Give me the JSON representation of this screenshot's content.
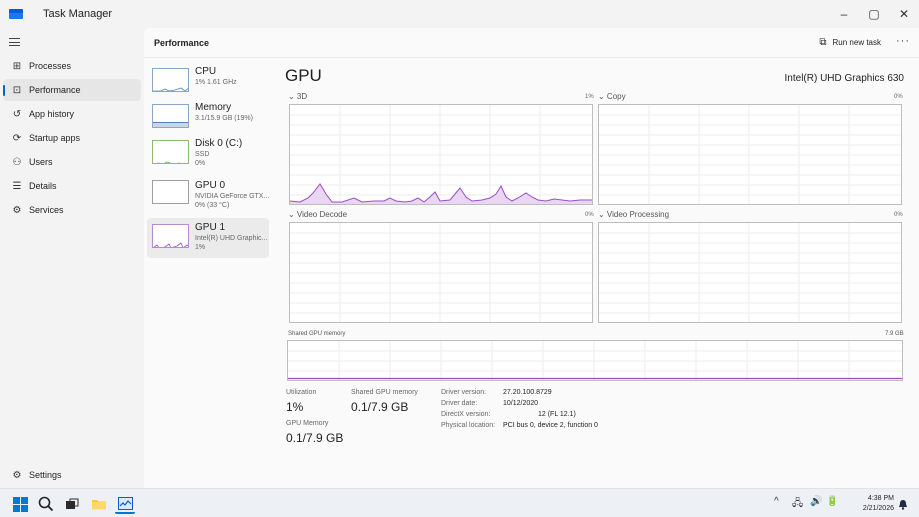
{
  "window": {
    "title": "Task Manager",
    "minimize": "–",
    "maximize": "▢",
    "close": "✕"
  },
  "nav": {
    "items": [
      {
        "label": "Processes",
        "icon": "⊞"
      },
      {
        "label": "Performance",
        "icon": "⊡"
      },
      {
        "label": "App history",
        "icon": "↺"
      },
      {
        "label": "Startup apps",
        "icon": "⟳"
      },
      {
        "label": "Users",
        "icon": "⚇"
      },
      {
        "label": "Details",
        "icon": "☰"
      },
      {
        "label": "Services",
        "icon": "⚙"
      }
    ],
    "settings": {
      "label": "Settings",
      "icon": "⚙"
    }
  },
  "header": {
    "title": "Performance",
    "run_new_task": "Run new task",
    "more": "···"
  },
  "devices": [
    {
      "name": "CPU",
      "sub1": "1% 1.61 GHz",
      "sub2": ""
    },
    {
      "name": "Memory",
      "sub1": "3.1/15.9 GB (19%)",
      "sub2": ""
    },
    {
      "name": "Disk 0 (C:)",
      "sub1": "SSD",
      "sub2": "0%"
    },
    {
      "name": "GPU 0",
      "sub1": "NVIDIA GeForce GTX...",
      "sub2": "0% (33 °C)"
    },
    {
      "name": "GPU 1",
      "sub1": "Intel(R) UHD Graphic...",
      "sub2": "1%"
    }
  ],
  "detail": {
    "title": "GPU",
    "model": "Intel(R) UHD Graphics 630",
    "graphs": [
      {
        "label": "⌄ 3D",
        "pct": "1%"
      },
      {
        "label": "⌄ Copy",
        "pct": "0%"
      },
      {
        "label": "⌄ Video Decode",
        "pct": "0%"
      },
      {
        "label": "⌄ Video Processing",
        "pct": "0%"
      }
    ],
    "shared_mem": {
      "label": "Shared GPU memory",
      "max": "7.9 GB"
    },
    "stats": {
      "utilization_label": "Utilization",
      "utilization_value": "1%",
      "shared_label": "Shared GPU memory",
      "shared_value": "0.1/7.9 GB",
      "gpu_mem_label": "GPU Memory",
      "gpu_mem_value": "0.1/7.9 GB"
    },
    "info": [
      {
        "label": "Driver version:",
        "value": "27.20.100.8729"
      },
      {
        "label": "Driver date:",
        "value": "10/12/2020"
      },
      {
        "label": "DirectX version:",
        "value": "12 (FL 12.1)"
      },
      {
        "label": "Physical location:",
        "value": "PCI bus 0, device 2, function 0"
      }
    ]
  },
  "taskbar": {
    "tray": {
      "chevron": "^",
      "network": "🖧",
      "volume": "🔊",
      "battery": "🔋"
    },
    "time": "4:38 PM",
    "date": "2/21/2026"
  },
  "colors": {
    "accent": "#0067c0",
    "gpu_graph_line": "#9b4ec2",
    "gpu_graph_fill": "#e8d6f3"
  }
}
